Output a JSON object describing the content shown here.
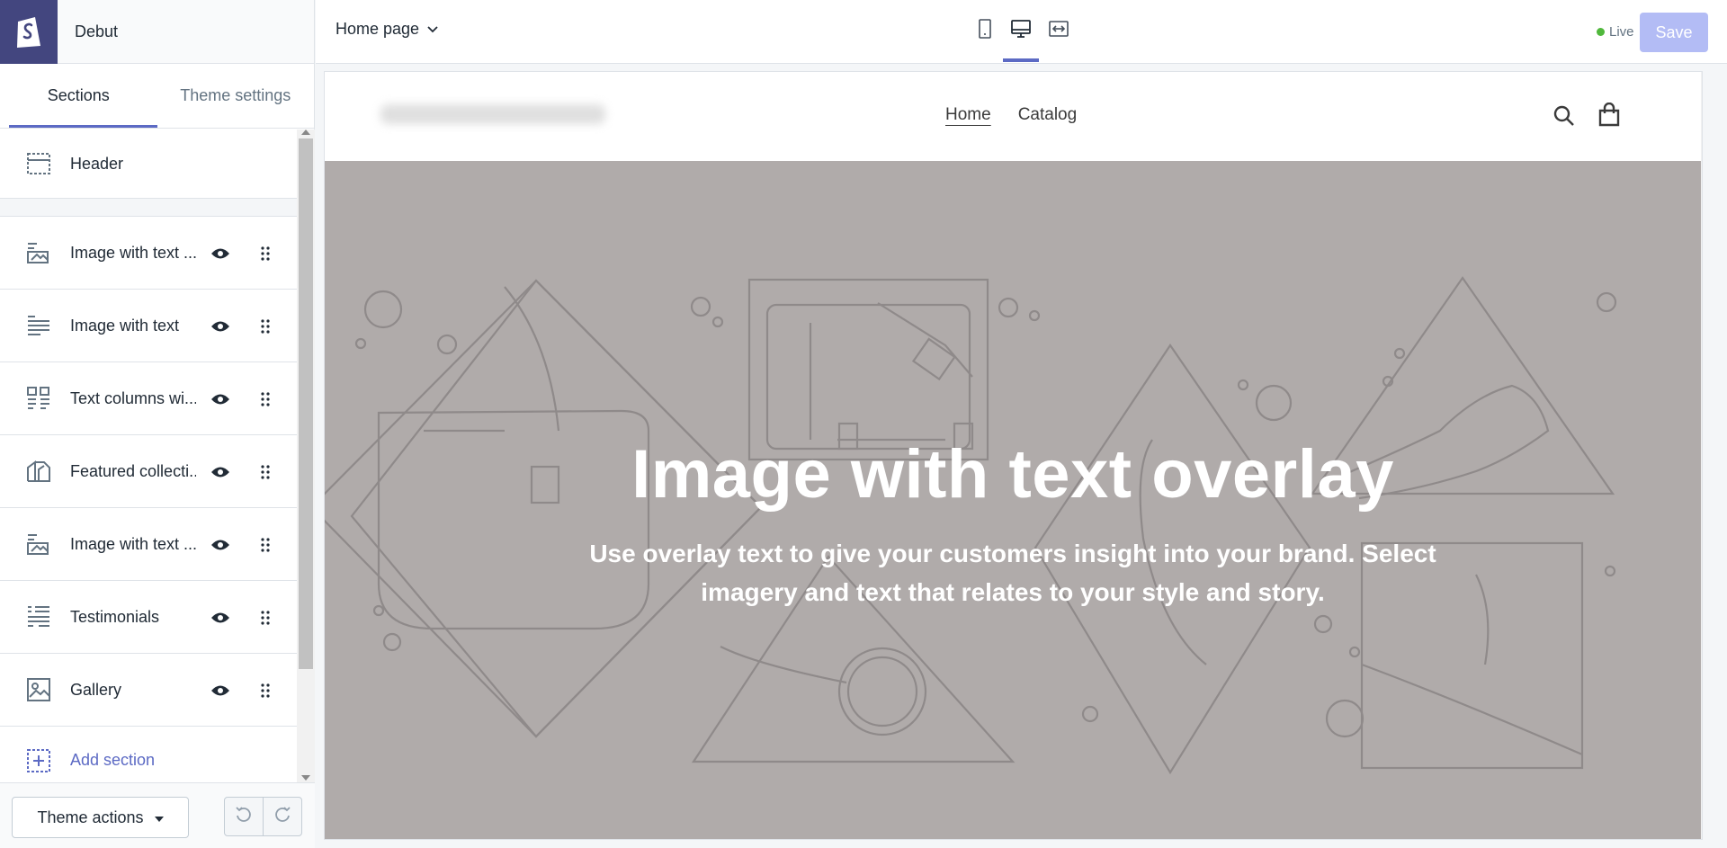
{
  "sidebar": {
    "theme_name": "Debut",
    "tabs": [
      {
        "label": "Sections",
        "active": true
      },
      {
        "label": "Theme settings",
        "active": false
      }
    ],
    "header_item": {
      "label": "Header",
      "icon": "header-icon"
    },
    "sections": [
      {
        "label": "Image with text ...",
        "icon": "image-with-text-overlay-icon"
      },
      {
        "label": "Image with text",
        "icon": "text-lines-icon"
      },
      {
        "label": "Text columns wi...",
        "icon": "text-columns-icon"
      },
      {
        "label": "Featured collecti...",
        "icon": "collection-icon"
      },
      {
        "label": "Image with text ...",
        "icon": "image-with-text-overlay-icon"
      },
      {
        "label": "Testimonials",
        "icon": "testimonials-icon"
      },
      {
        "label": "Gallery",
        "icon": "gallery-icon"
      }
    ],
    "add_section": "Add section",
    "footer": {
      "theme_actions": "Theme actions"
    }
  },
  "topbar": {
    "page_select": "Home page",
    "live_label": "Live",
    "save_label": "Save"
  },
  "preview": {
    "nav": [
      {
        "label": "Home",
        "active": true
      },
      {
        "label": "Catalog",
        "active": false
      }
    ],
    "hero": {
      "title": "Image with text overlay",
      "text": "Use overlay text to give your customers insight into your brand. Select imagery and text that relates to your style and story."
    }
  },
  "colors": {
    "accent": "#5c6ac4",
    "brand": "#43467f",
    "save_disabled": "#b3bcf5",
    "live": "#50b83c",
    "hero_bg": "#b0abaa"
  }
}
